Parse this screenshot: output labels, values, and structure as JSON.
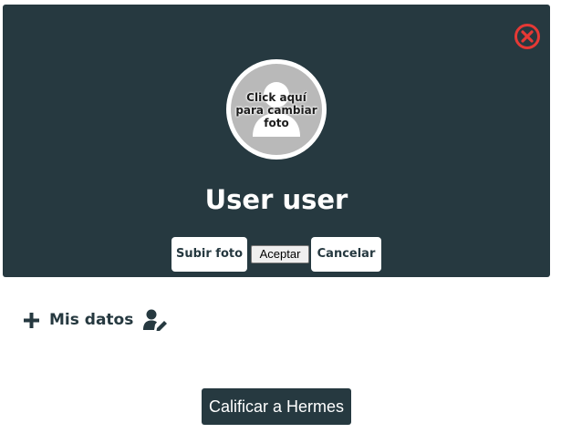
{
  "profile": {
    "user_name": "User user",
    "avatar_overlay": "Click aquí\npara cambiar\nfoto",
    "avatar_icon": "user-silhouette-icon",
    "close_icon": "close-circle-icon"
  },
  "photo_actions": {
    "upload_label": "Subir foto",
    "accept_label": "Aceptar",
    "cancel_label": "Cancelar"
  },
  "section": {
    "mis_datos_label": "Mis datos",
    "expand_icon": "plus-icon",
    "edit_icon": "user-edit-icon"
  },
  "footer": {
    "rate_button_label": "Calificar a Hermes"
  },
  "colors": {
    "panel_bg": "#263940",
    "close_red": "#e53935",
    "avatar_gray": "#b9b9b9",
    "text_dark": "#263940"
  }
}
